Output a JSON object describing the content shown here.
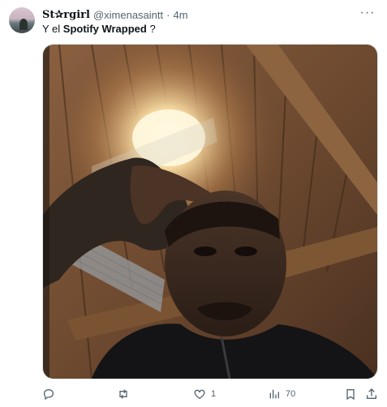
{
  "user": {
    "display_name": "St✰rgirl",
    "handle": "@ximenasaintt",
    "separator": "·",
    "time": "4m"
  },
  "tweet": {
    "text_prefix": "Y el ",
    "text_bold": "Spotify Wrapped",
    "text_suffix": " ?"
  },
  "actions": {
    "reply_count": "",
    "retweet_count": "",
    "like_count": "1",
    "views_count": "70"
  },
  "icons": [
    "more-icon",
    "reply-icon",
    "retweet-icon",
    "like-icon",
    "views-icon",
    "bookmark-icon",
    "share-icon"
  ],
  "colors": {
    "muted": "#536471",
    "text": "#0f1419"
  }
}
